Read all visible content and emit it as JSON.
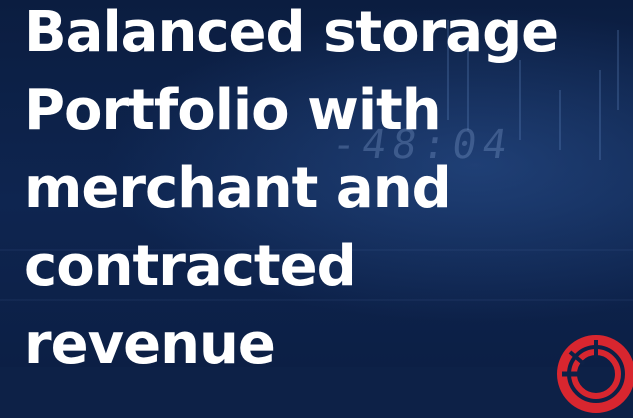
{
  "headline": {
    "line1": "Balanced storage",
    "line2": "Portfolio with",
    "line3": "merchant and",
    "line4": "contracted",
    "line5": "revenue"
  },
  "background": {
    "display_text": "-48:04"
  },
  "colors": {
    "background": "#0d2147",
    "headline": "#ffffff",
    "logo": "#d8262f"
  },
  "icons": {
    "logo": "red-ring-logo-icon"
  }
}
